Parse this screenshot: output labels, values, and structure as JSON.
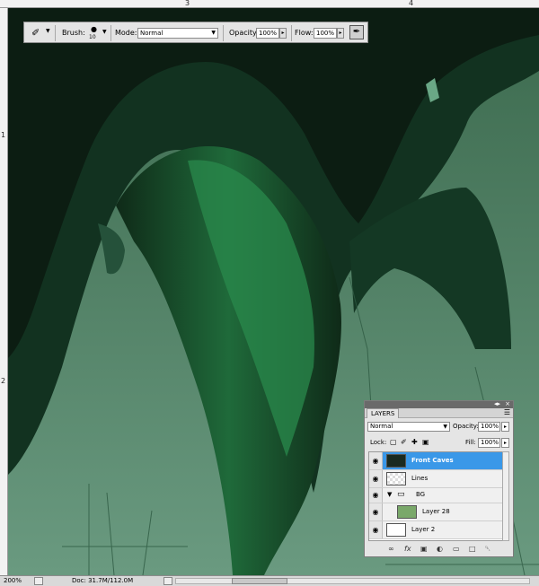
{
  "rulers": {
    "top_labels": [
      "3",
      "4"
    ],
    "left_labels": [
      "1",
      "2"
    ]
  },
  "options_bar": {
    "tool_icon": "brush-icon",
    "brush_label": "Brush:",
    "brush_size": "10",
    "mode_label": "Mode:",
    "mode_value": "Normal",
    "opacity_label": "Opacity:",
    "opacity_value": "100%",
    "flow_label": "Flow:",
    "flow_value": "100%",
    "airbrush_icon": "airbrush-icon"
  },
  "layers_panel": {
    "tab_label": "LAYERS",
    "blend_mode": "Normal",
    "opacity_label": "Opacity:",
    "opacity_value": "100%",
    "lock_label": "Lock:",
    "fill_label": "Fill:",
    "fill_value": "100%",
    "layers": [
      {
        "name": "Front Caves",
        "selected": true,
        "type": "layer"
      },
      {
        "name": "Lines",
        "selected": false,
        "type": "layer"
      },
      {
        "name": "BG",
        "selected": false,
        "type": "group"
      },
      {
        "name": "Layer 28",
        "selected": false,
        "type": "layer"
      },
      {
        "name": "Layer 2",
        "selected": false,
        "type": "layer"
      }
    ],
    "bottom_icons": [
      "link-icon",
      "fx-icon",
      "mask-icon",
      "adjustment-icon",
      "folder-icon",
      "new-layer-icon",
      "trash-icon"
    ]
  },
  "status_bar": {
    "zoom": "200%",
    "doc_info": "Doc: 31.7M/112.0M"
  },
  "colors": {
    "canvas_light": "#5c8a70",
    "canvas_dark": "#0f2316",
    "accent_selected": "#3a98e8"
  }
}
